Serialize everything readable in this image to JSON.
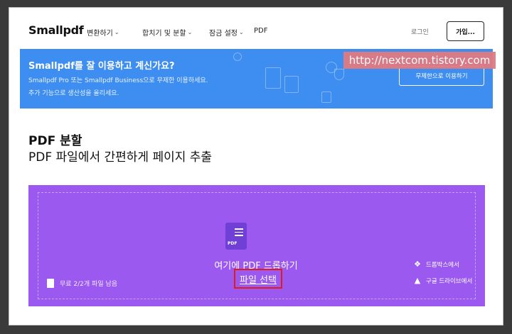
{
  "header": {
    "logo": "Smallpdf",
    "nav": [
      {
        "label": "변환하기",
        "caret": "⌄"
      },
      {
        "label": "합치기 및 분할",
        "caret": "⌄"
      },
      {
        "label": "잠금 설정",
        "caret": "⌄"
      },
      {
        "label": "PDF",
        "caret": ""
      }
    ],
    "login": "로그인",
    "signup": "가입..."
  },
  "banner": {
    "title": "Smallpdf를 잘 이용하고 계신가요?",
    "line1": "Smallpdf Pro 또는 Smallpdf Business으로 무제한 이용하세요.",
    "line2": "추가 기능으로 생산성을 올리세요.",
    "button": "무제한으로 이용하기"
  },
  "watermark": "http://nextcom.tistory.com",
  "page": {
    "title": "PDF 분할",
    "subtitle": "PDF 파일에서 간편하게 페이지 추출"
  },
  "dropzone": {
    "icon_label": "PDF",
    "drop_text": "여기에 PDF 드롭하기",
    "choose_file": "파일 선택",
    "quota": "무료 2/2개 파일 남음",
    "dropbox": "드롭박스에서",
    "gdrive": "구글 드라이브에서"
  },
  "colors": {
    "banner": "#3d8ef0",
    "dropzone": "#9b59f0",
    "highlight": "#e01c1c"
  }
}
